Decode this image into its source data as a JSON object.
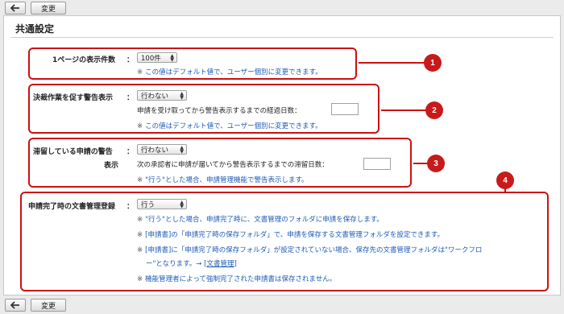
{
  "toolbar": {
    "change_label": "変更"
  },
  "page": {
    "title": "共通設定"
  },
  "sections": {
    "s1": {
      "label": "1ページの表示件数",
      "select_value": "100件",
      "note": "この値はデフォルト値で、ユーザー個別に変更できます。",
      "badge": "1"
    },
    "s2": {
      "label": "決裁作業を促す警告表示",
      "select_value": "行わない",
      "days_label": "申請を受け取ってから警告表示するまでの経過日数：",
      "note": "この値はデフォルト値で、ユーザー個別に変更できます。",
      "badge": "2"
    },
    "s3": {
      "label_line1": "滞留している申請の警告",
      "label_line2": "表示",
      "select_value": "行わない",
      "days_label": "次の承認者に申請が届いてから警告表示するまでの滞留日数：",
      "note": "\"行う\"とした場合、申請管理機能で警告表示します。",
      "badge": "3"
    },
    "s4": {
      "label": "申請完了時の文書管理登録",
      "select_value": "行う",
      "note1": "\"行う\"とした場合、申請完了時に、文書管理のフォルダに申請を保存します。",
      "note2": "[申請書]の「申請完了時の保存フォルダ」で、申請を保存する文書管理フォルダを設定できます。",
      "note3a": "[申請書]に「申請完了時の保存フォルダ」が設定されていない場合、保存先の文書管理フォルダは\"ワークフロ",
      "note3b": "ー\"となります。→ [",
      "note3_link": "文書管理",
      "note3c": "]",
      "note4": "機能管理者によって強制完了された申請書は保存されません。",
      "badge": "4"
    }
  },
  "colon": "：",
  "asterisk": "※",
  "colors": {
    "accent_red": "#cc1111",
    "note_blue": "#1e5bb8"
  }
}
